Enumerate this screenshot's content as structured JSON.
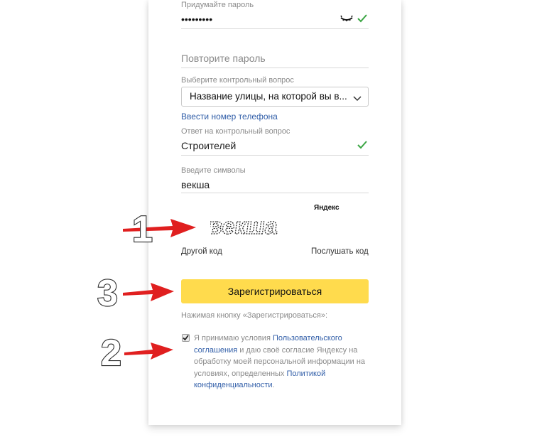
{
  "password": {
    "label": "Придумайте пароль",
    "masked_value": "•••••••••",
    "visibility_icon": "eye-closed-icon",
    "valid_icon": "checkmark-icon"
  },
  "repeat_password": {
    "placeholder": "Повторите пароль"
  },
  "security_question": {
    "label": "Выберите контрольный вопрос",
    "selected": "Название улицы, на которой вы в...",
    "phone_link": "Ввести номер телефона"
  },
  "answer": {
    "label": "Ответ на контрольный вопрос",
    "value": "Строителей",
    "valid_icon": "checkmark-icon"
  },
  "captcha": {
    "label": "Введите символы",
    "value": "векша",
    "image_text": "векша",
    "brand": "Яндекс",
    "other_code": "Другой код",
    "listen_code": "Послушать код"
  },
  "register": {
    "button_label": "Зарегистрироваться",
    "note": "Нажимая кнопку «Зарегистрироваться»:"
  },
  "terms": {
    "checked": true,
    "text_1": "Я принимаю условия ",
    "link_1": "Пользовательского соглашения",
    "text_2": " и даю своё согласие Яндексу на обработку моей персональной информации на условиях, определенных ",
    "link_2": "Политикой конфиденциальности",
    "text_3": "."
  },
  "annotations": {
    "step_1": "1",
    "step_2": "2",
    "step_3": "3",
    "arrow_color": "#e01f1f"
  },
  "colors": {
    "accent_button": "#ffdb4d",
    "link": "#315ea8",
    "valid": "#3aa543"
  }
}
